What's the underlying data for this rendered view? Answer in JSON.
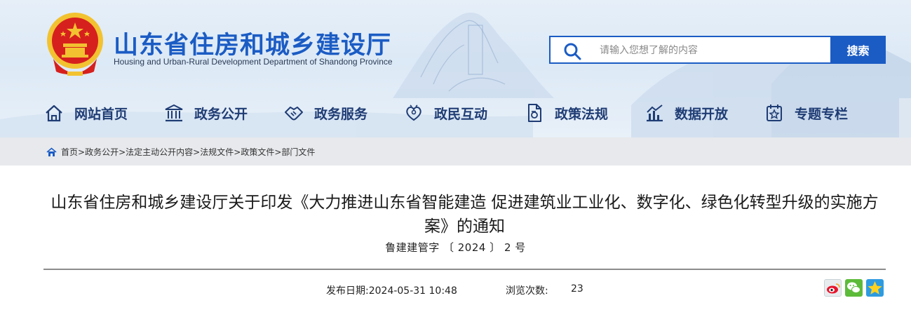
{
  "header": {
    "title": "山东省住房和城乡建设厅",
    "subtitle": "Housing and Urban-Rural Development Department of Shandong Province"
  },
  "search": {
    "placeholder": "请输入您想了解的内容",
    "button_label": "搜索"
  },
  "nav": {
    "items": [
      {
        "label": "网站首页",
        "icon": "home-icon"
      },
      {
        "label": "政务公开",
        "icon": "building-icon"
      },
      {
        "label": "政务服务",
        "icon": "handshake-icon"
      },
      {
        "label": "政民互动",
        "icon": "heart-people-icon"
      },
      {
        "label": "政策法规",
        "icon": "document-icon"
      },
      {
        "label": "数据开放",
        "icon": "bar-chart-icon"
      },
      {
        "label": "专题专栏",
        "icon": "star-calendar-icon"
      }
    ]
  },
  "breadcrumb": {
    "items": [
      "首页",
      "政务公开",
      "法定主动公开内容",
      "法规文件",
      "政策文件",
      "部门文件"
    ],
    "separator": ">"
  },
  "article": {
    "title": "山东省住房和城乡建设厅关于印发《大力推进山东省智能建造 促进建筑业工业化、数字化、绿色化转型升级的实施方案》的通知",
    "doc_number": "鲁建建管字 〔 2024 〕 2 号",
    "publish_date": "发布日期:2024-05-31 10:48",
    "views_label": "浏览次数:",
    "views_count": "23"
  },
  "share": {
    "icons": [
      "weibo-icon",
      "wechat-icon",
      "qzone-icon"
    ]
  },
  "colors": {
    "brand_blue": "#1b5cc4",
    "nav_text": "#1f3c74",
    "breadcrumb_bg": "#e7e9ec",
    "emblem_red": "#d6201e",
    "emblem_gold": "#f2c230"
  }
}
